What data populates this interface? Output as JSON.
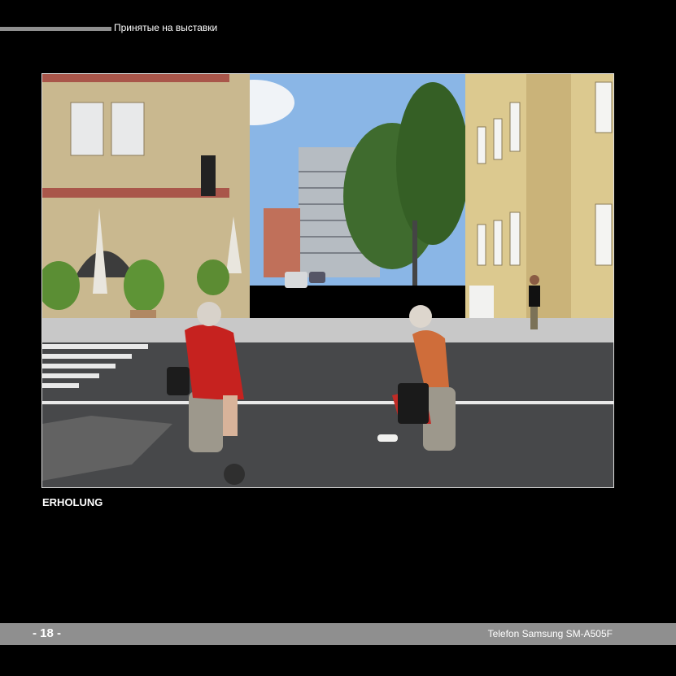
{
  "header": {
    "section_title": "Принятые на выставки"
  },
  "photo": {
    "caption": "ERHOLUNG"
  },
  "footer": {
    "page_number": "- 18 -",
    "camera": "Telefon Samsung SM-A505F"
  }
}
